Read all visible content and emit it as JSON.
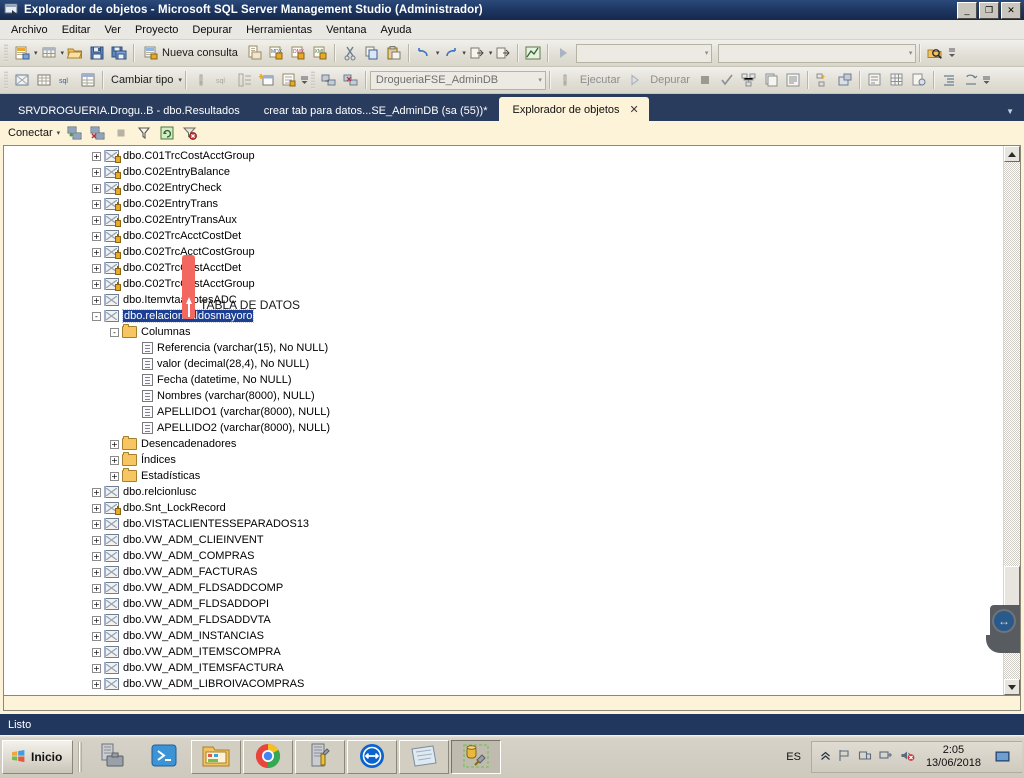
{
  "window": {
    "title": "Explorador de objetos - Microsoft SQL Server Management Studio (Administrador)",
    "icon": "ssms-icon",
    "minimize": "_",
    "maximize": "❐",
    "close": "✕"
  },
  "menu": {
    "items": [
      {
        "label": "Archivo",
        "name": "menu-archivo"
      },
      {
        "label": "Editar",
        "name": "menu-editar"
      },
      {
        "label": "Ver",
        "name": "menu-ver"
      },
      {
        "label": "Proyecto",
        "name": "menu-proyecto"
      },
      {
        "label": "Depurar",
        "name": "menu-depurar"
      },
      {
        "label": "Herramientas",
        "name": "menu-herramientas"
      },
      {
        "label": "Ventana",
        "name": "menu-ventana"
      },
      {
        "label": "Ayuda",
        "name": "menu-ayuda"
      }
    ]
  },
  "toolbar1": {
    "new_query_label": "Nueva consulta",
    "combo1_value": "",
    "combo2_value": ""
  },
  "toolbar2": {
    "change_type_label": "Cambiar tipo",
    "database_value": "DrogueriaFSE_AdminDB",
    "execute_label": "Ejecutar",
    "debug_label": "Depurar"
  },
  "tabs": [
    {
      "label": "SRVDROGUERIA.Drogu..B - dbo.Resultados",
      "active": false,
      "name": "tab-resultados"
    },
    {
      "label": "crear tab para datos...SE_AdminDB (sa (55))*",
      "active": false,
      "name": "tab-crear-tab-datos"
    },
    {
      "label": "Explorador de objetos",
      "active": true,
      "close": "✕",
      "name": "tab-explorador-objetos"
    }
  ],
  "object_explorer": {
    "connect_label": "Conectar",
    "connect_caret": "▾",
    "toolbar_icons": [
      "connect-icon",
      "disconnect-icon",
      "stop-icon",
      "filter-icon",
      "refresh-icon",
      "remove-filter-icon"
    ]
  },
  "annotation": {
    "text": "TABLA DE DATOS",
    "color": "#f2675f",
    "arrow": "up-arrow"
  },
  "tree": [
    {
      "indent": 0,
      "expander": "+",
      "icon": "table-locked-icon",
      "label": "dbo.C01TrcCostAcctGroup"
    },
    {
      "indent": 0,
      "expander": "+",
      "icon": "table-locked-icon",
      "label": "dbo.C02EntryBalance"
    },
    {
      "indent": 0,
      "expander": "+",
      "icon": "table-locked-icon",
      "label": "dbo.C02EntryCheck"
    },
    {
      "indent": 0,
      "expander": "+",
      "icon": "table-locked-icon",
      "label": "dbo.C02EntryTrans"
    },
    {
      "indent": 0,
      "expander": "+",
      "icon": "table-locked-icon",
      "label": "dbo.C02EntryTransAux"
    },
    {
      "indent": 0,
      "expander": "+",
      "icon": "table-locked-icon",
      "label": "dbo.C02TrcAcctCostDet"
    },
    {
      "indent": 0,
      "expander": "+",
      "icon": "table-locked-icon",
      "label": "dbo.C02TrcAcctCostGroup"
    },
    {
      "indent": 0,
      "expander": "+",
      "icon": "table-locked-icon",
      "label": "dbo.C02TrcCostAcctDet"
    },
    {
      "indent": 0,
      "expander": "+",
      "icon": "table-locked-icon",
      "label": "dbo.C02TrcCostAcctGroup"
    },
    {
      "indent": 0,
      "expander": "+",
      "icon": "table-icon",
      "label": "dbo.ItemvtaaLotesADC"
    },
    {
      "indent": 0,
      "expander": "-",
      "icon": "table-icon",
      "label": "dbo.relacionsaldosmayoro",
      "selected": true
    },
    {
      "indent": 1,
      "expander": "-",
      "icon": "folder-icon",
      "label": "Columnas"
    },
    {
      "indent": 2,
      "expander": "",
      "icon": "column-icon",
      "label": "Referencia (varchar(15), No NULL)"
    },
    {
      "indent": 2,
      "expander": "",
      "icon": "column-icon",
      "label": "valor (decimal(28,4), No NULL)"
    },
    {
      "indent": 2,
      "expander": "",
      "icon": "column-icon",
      "label": "Fecha (datetime, No NULL)"
    },
    {
      "indent": 2,
      "expander": "",
      "icon": "column-icon",
      "label": "Nombres (varchar(8000), NULL)"
    },
    {
      "indent": 2,
      "expander": "",
      "icon": "column-icon",
      "label": "APELLIDO1 (varchar(8000), NULL)"
    },
    {
      "indent": 2,
      "expander": "",
      "icon": "column-icon",
      "label": "APELLIDO2 (varchar(8000), NULL)"
    },
    {
      "indent": 1,
      "expander": "+",
      "icon": "folder-icon",
      "label": "Desencadenadores"
    },
    {
      "indent": 1,
      "expander": "+",
      "icon": "folder-icon",
      "label": "Índices"
    },
    {
      "indent": 1,
      "expander": "+",
      "icon": "folder-icon",
      "label": "Estadísticas"
    },
    {
      "indent": 0,
      "expander": "+",
      "icon": "table-icon",
      "label": "dbo.relcionlusc"
    },
    {
      "indent": 0,
      "expander": "+",
      "icon": "table-locked-icon",
      "label": "dbo.Snt_LockRecord"
    },
    {
      "indent": 0,
      "expander": "+",
      "icon": "table-icon",
      "label": "dbo.VISTACLIENTESSEPARADOS13"
    },
    {
      "indent": 0,
      "expander": "+",
      "icon": "table-icon",
      "label": "dbo.VW_ADM_CLIEINVENT"
    },
    {
      "indent": 0,
      "expander": "+",
      "icon": "table-icon",
      "label": "dbo.VW_ADM_COMPRAS"
    },
    {
      "indent": 0,
      "expander": "+",
      "icon": "table-icon",
      "label": "dbo.VW_ADM_FACTURAS"
    },
    {
      "indent": 0,
      "expander": "+",
      "icon": "table-icon",
      "label": "dbo.VW_ADM_FLDSADDCOMP"
    },
    {
      "indent": 0,
      "expander": "+",
      "icon": "table-icon",
      "label": "dbo.VW_ADM_FLDSADDOPI"
    },
    {
      "indent": 0,
      "expander": "+",
      "icon": "table-icon",
      "label": "dbo.VW_ADM_FLDSADDVTA"
    },
    {
      "indent": 0,
      "expander": "+",
      "icon": "table-icon",
      "label": "dbo.VW_ADM_INSTANCIAS"
    },
    {
      "indent": 0,
      "expander": "+",
      "icon": "table-icon",
      "label": "dbo.VW_ADM_ITEMSCOMPRA"
    },
    {
      "indent": 0,
      "expander": "+",
      "icon": "table-icon",
      "label": "dbo.VW_ADM_ITEMSFACTURA"
    },
    {
      "indent": 0,
      "expander": "+",
      "icon": "table-icon",
      "label": "dbo.VW_ADM_LIBROIVACOMPRAS"
    }
  ],
  "status": {
    "text": "Listo"
  },
  "taskbar": {
    "start_label": "Inicio",
    "items": [
      {
        "name": "taskitem-server-manager",
        "icon": "server-toolbox-icon",
        "framed": false
      },
      {
        "name": "taskitem-powershell",
        "icon": "powershell-icon",
        "framed": false
      },
      {
        "name": "taskitem-explorer",
        "icon": "folder-explorer-icon",
        "framed": true
      },
      {
        "name": "taskitem-chrome",
        "icon": "chrome-icon",
        "framed": true
      },
      {
        "name": "taskitem-config-tools",
        "icon": "server-wrench-icon",
        "framed": true
      },
      {
        "name": "taskitem-teamviewer",
        "icon": "teamviewer-icon",
        "framed": true
      },
      {
        "name": "taskitem-notepad",
        "icon": "notepad-icon",
        "framed": true
      },
      {
        "name": "taskitem-ssms",
        "icon": "ssms-icon",
        "framed": true,
        "active": true
      }
    ],
    "lang": "ES",
    "tray_icons": [
      "chevron-up-icon",
      "flag-icon",
      "action-center-icon",
      "network-icon",
      "volume-muted-icon"
    ],
    "time": "2:05",
    "date": "13/06/2018",
    "show_desktop": "show-desktop-icon"
  }
}
